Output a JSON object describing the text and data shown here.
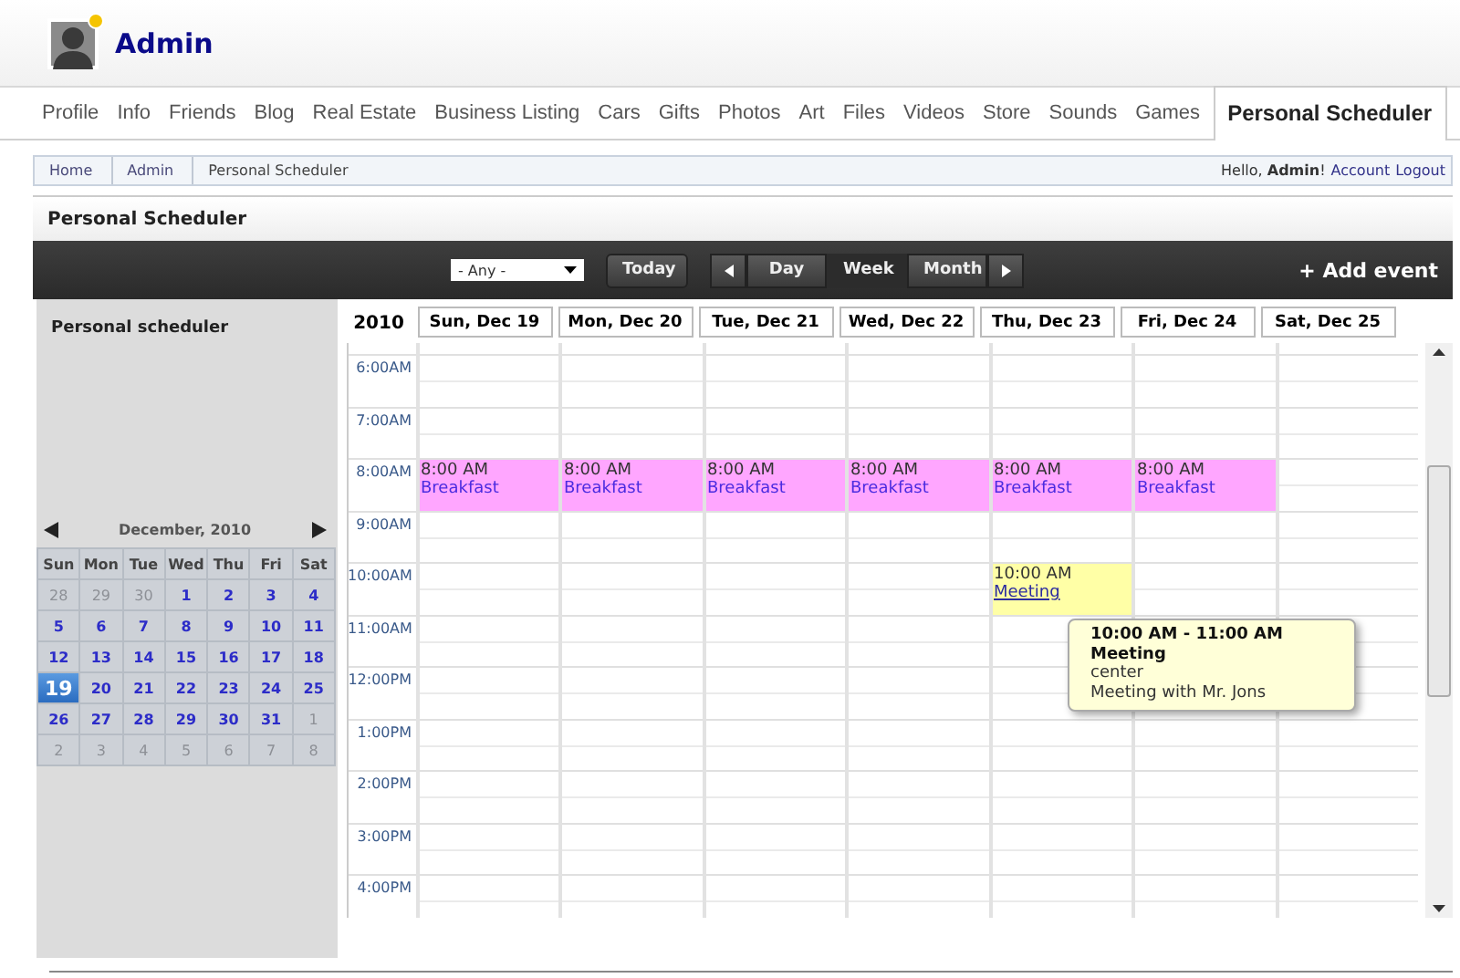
{
  "profile": {
    "name": "Admin",
    "online": true
  },
  "tabs": [
    {
      "label": "Profile",
      "selected": false
    },
    {
      "label": "Info",
      "selected": false
    },
    {
      "label": "Friends",
      "selected": false
    },
    {
      "label": "Blog",
      "selected": false
    },
    {
      "label": "Real Estate",
      "selected": false
    },
    {
      "label": "Business Listing",
      "selected": false
    },
    {
      "label": "Cars",
      "selected": false
    },
    {
      "label": "Gifts",
      "selected": false
    },
    {
      "label": "Photos",
      "selected": false
    },
    {
      "label": "Art",
      "selected": false
    },
    {
      "label": "Files",
      "selected": false
    },
    {
      "label": "Videos",
      "selected": false
    },
    {
      "label": "Store",
      "selected": false
    },
    {
      "label": "Sounds",
      "selected": false
    },
    {
      "label": "Games",
      "selected": false
    },
    {
      "label": "Personal Scheduler",
      "selected": true
    }
  ],
  "breadcrumb": [
    "Home",
    "Admin",
    "Personal Scheduler"
  ],
  "user_bar": {
    "greeting": "Hello, **Admin**!",
    "links": [
      "Account",
      "Logout"
    ]
  },
  "panel_title": "Personal Scheduler",
  "toolbar": {
    "filter": "- Any -",
    "today": "Today",
    "views": [
      {
        "label": "Day",
        "selected": false
      },
      {
        "label": "Week",
        "selected": true
      },
      {
        "label": "Month",
        "selected": false
      }
    ],
    "add": "+ Add event"
  },
  "sidebar": {
    "title": "Personal scheduler",
    "month": "December, 2010",
    "weekdays": [
      "Sun",
      "Mon",
      "Tue",
      "Wed",
      "Thu",
      "Fri",
      "Sat"
    ],
    "weeks": [
      [
        {
          "d": "28",
          "muted": true,
          "selected": false
        },
        {
          "d": "29",
          "muted": true,
          "selected": false
        },
        {
          "d": "30",
          "muted": true,
          "selected": false
        },
        {
          "d": "1",
          "muted": false,
          "selected": false
        },
        {
          "d": "2",
          "muted": false,
          "selected": false
        },
        {
          "d": "3",
          "muted": false,
          "selected": false
        },
        {
          "d": "4",
          "muted": false,
          "selected": false
        }
      ],
      [
        {
          "d": "5",
          "muted": false,
          "selected": false
        },
        {
          "d": "6",
          "muted": false,
          "selected": false
        },
        {
          "d": "7",
          "muted": false,
          "selected": false
        },
        {
          "d": "8",
          "muted": false,
          "selected": false
        },
        {
          "d": "9",
          "muted": false,
          "selected": false
        },
        {
          "d": "10",
          "muted": false,
          "selected": false
        },
        {
          "d": "11",
          "muted": false,
          "selected": false
        }
      ],
      [
        {
          "d": "12",
          "muted": false,
          "selected": false
        },
        {
          "d": "13",
          "muted": false,
          "selected": false
        },
        {
          "d": "14",
          "muted": false,
          "selected": false
        },
        {
          "d": "15",
          "muted": false,
          "selected": false
        },
        {
          "d": "16",
          "muted": false,
          "selected": false
        },
        {
          "d": "17",
          "muted": false,
          "selected": false
        },
        {
          "d": "18",
          "muted": false,
          "selected": false
        }
      ],
      [
        {
          "d": "19",
          "muted": false,
          "selected": true
        },
        {
          "d": "20",
          "muted": false,
          "selected": false
        },
        {
          "d": "21",
          "muted": false,
          "selected": false
        },
        {
          "d": "22",
          "muted": false,
          "selected": false
        },
        {
          "d": "23",
          "muted": false,
          "selected": false
        },
        {
          "d": "24",
          "muted": false,
          "selected": false
        },
        {
          "d": "25",
          "muted": false,
          "selected": false
        }
      ],
      [
        {
          "d": "26",
          "muted": false,
          "selected": false
        },
        {
          "d": "27",
          "muted": false,
          "selected": false
        },
        {
          "d": "28",
          "muted": false,
          "selected": false
        },
        {
          "d": "29",
          "muted": false,
          "selected": false
        },
        {
          "d": "30",
          "muted": false,
          "selected": false
        },
        {
          "d": "31",
          "muted": false,
          "selected": false
        },
        {
          "d": "1",
          "muted": true,
          "selected": false
        }
      ],
      [
        {
          "d": "2",
          "muted": true,
          "selected": false
        },
        {
          "d": "3",
          "muted": true,
          "selected": false
        },
        {
          "d": "4",
          "muted": true,
          "selected": false
        },
        {
          "d": "5",
          "muted": true,
          "selected": false
        },
        {
          "d": "6",
          "muted": true,
          "selected": false
        },
        {
          "d": "7",
          "muted": true,
          "selected": false
        },
        {
          "d": "8",
          "muted": true,
          "selected": false
        }
      ]
    ]
  },
  "calendar": {
    "year": "2010",
    "hours": [
      "6:00AM",
      "7:00AM",
      "8:00AM",
      "9:00AM",
      "10:00AM",
      "11:00AM",
      "12:00PM",
      "1:00PM",
      "2:00PM",
      "3:00PM",
      "4:00PM"
    ],
    "days": [
      {
        "label": "Sun, Dec 19",
        "events": [
          {
            "time": "8:00 AM",
            "title": "Breakfast",
            "color": "#ffa6ff"
          }
        ]
      },
      {
        "label": "Mon, Dec 20",
        "events": [
          {
            "time": "8:00 AM",
            "title": "Breakfast",
            "color": "#ffa6ff"
          }
        ]
      },
      {
        "label": "Tue, Dec 21",
        "events": [
          {
            "time": "8:00 AM",
            "title": "Breakfast",
            "color": "#ffa6ff"
          }
        ]
      },
      {
        "label": "Wed, Dec 22",
        "events": [
          {
            "time": "8:00 AM",
            "title": "Breakfast",
            "color": "#ffa6ff"
          }
        ]
      },
      {
        "label": "Thu, Dec 23",
        "events": [
          {
            "time": "8:00 AM",
            "title": "Breakfast",
            "color": "#ffa6ff"
          },
          {
            "time": "10:00 AM",
            "title": "Meeting",
            "color": "#ffffa6",
            "link": true,
            "tooltip": {
              "range": "10:00 AM - 11:00 AM",
              "title": "Meeting",
              "place": "center",
              "note": "Meeting with Mr. Jons"
            }
          }
        ]
      },
      {
        "label": "Fri, Dec 24",
        "events": [
          {
            "time": "8:00 AM",
            "title": "Breakfast",
            "color": "#ffa6ff"
          }
        ]
      },
      {
        "label": "Sat, Dec 25"
      }
    ]
  }
}
